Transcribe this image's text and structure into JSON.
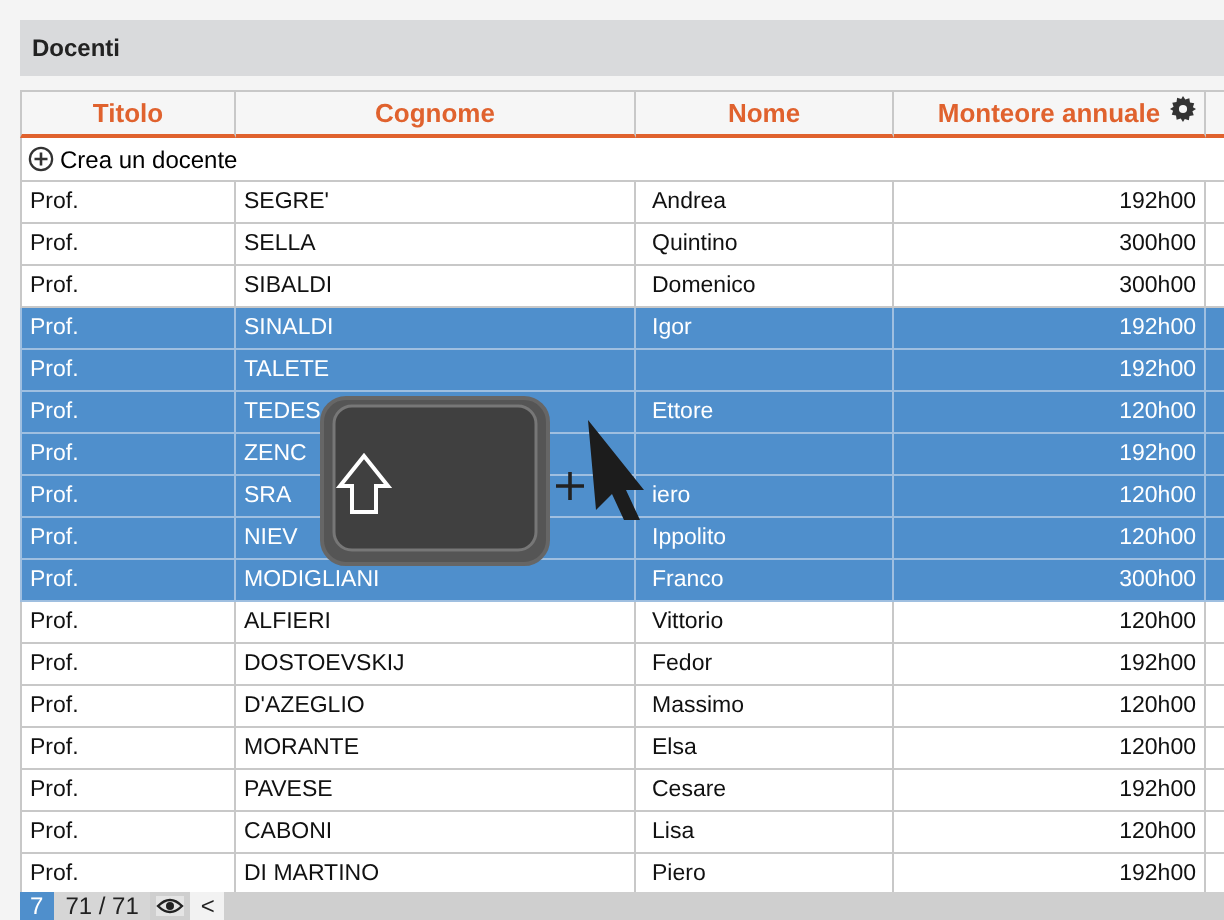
{
  "panel": {
    "title": "Docenti"
  },
  "table": {
    "columns": [
      "Titolo",
      "Cognome",
      "Nome",
      "Monteore annuale"
    ],
    "add_row": "Crea un docente",
    "rows": [
      {
        "titolo": "Prof.",
        "cognome": "SEGRE'",
        "nome": "Andrea",
        "monteore": "192h00",
        "selected": false
      },
      {
        "titolo": "Prof.",
        "cognome": "SELLA",
        "nome": "Quintino",
        "monteore": "300h00",
        "selected": false
      },
      {
        "titolo": "Prof.",
        "cognome": "SIBALDI",
        "nome": "Domenico",
        "monteore": "300h00",
        "selected": false
      },
      {
        "titolo": "Prof.",
        "cognome": "SINALDI",
        "nome": "Igor",
        "monteore": "192h00",
        "selected": true
      },
      {
        "titolo": "Prof.",
        "cognome": "TALETE",
        "monteore": "192h00",
        "selected": true
      },
      {
        "titolo": "Prof.",
        "cognome": "TEDES",
        "nome": "Ettore",
        "monteore": "120h00",
        "selected": true
      },
      {
        "titolo": "Prof.",
        "cognome": "ZENC",
        "monteore": "192h00",
        "selected": true
      },
      {
        "titolo": "Prof.",
        "cognome": "SRA",
        "nome": "iero",
        "monteore": "120h00",
        "selected": true
      },
      {
        "titolo": "Prof.",
        "cognome": "NIEV",
        "nome": "Ippolito",
        "monteore": "120h00",
        "selected": true
      },
      {
        "titolo": "Prof.",
        "cognome": "MODIGLIANI",
        "nome": "Franco",
        "monteore": "300h00",
        "selected": true
      },
      {
        "titolo": "Prof.",
        "cognome": "ALFIERI",
        "nome": "Vittorio",
        "monteore": "120h00",
        "selected": false
      },
      {
        "titolo": "Prof.",
        "cognome": "DOSTOEVSKIJ",
        "nome": "Fedor",
        "monteore": "192h00",
        "selected": false
      },
      {
        "titolo": "Prof.",
        "cognome": "D'AZEGLIO",
        "nome": "Massimo",
        "monteore": "120h00",
        "selected": false
      },
      {
        "titolo": "Prof.",
        "cognome": "MORANTE",
        "nome": "Elsa",
        "monteore": "120h00",
        "selected": false
      },
      {
        "titolo": "Prof.",
        "cognome": "PAVESE",
        "nome": "Cesare",
        "monteore": "192h00",
        "selected": false
      },
      {
        "titolo": "Prof.",
        "cognome": "CABONI",
        "nome": "Lisa",
        "monteore": "120h00",
        "selected": false
      },
      {
        "titolo": "Prof.",
        "cognome": "DI MARTINO",
        "nome": "Piero",
        "monteore": "192h00",
        "selected": false
      }
    ]
  },
  "footer": {
    "badge": "7",
    "count": "71 / 71",
    "back": "<"
  }
}
